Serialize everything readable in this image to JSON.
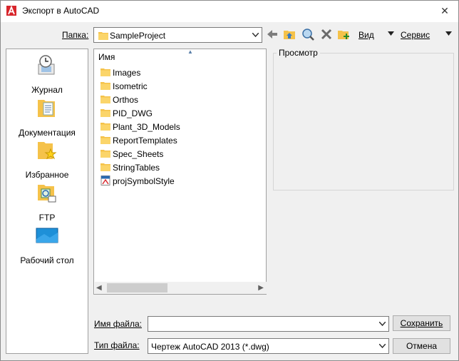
{
  "window": {
    "title": "Экспорт в AutoCAD",
    "close_glyph": "✕"
  },
  "lookin": {
    "label": "Папка:",
    "value": "SampleProject"
  },
  "toolbar": {
    "view_label": "Вид",
    "tools_label": "Сервис"
  },
  "places": [
    {
      "label": "Журнал",
      "icon": "history-icon"
    },
    {
      "label": "Документация",
      "icon": "documents-icon"
    },
    {
      "label": "Избранное",
      "icon": "favorites-icon"
    },
    {
      "label": "FTP",
      "icon": "ftp-icon"
    },
    {
      "label": "Рабочий стол",
      "icon": "desktop-icon"
    }
  ],
  "filelist": {
    "column_name": "Имя",
    "items": [
      {
        "name": "Images",
        "type": "folder"
      },
      {
        "name": "Isometric",
        "type": "folder"
      },
      {
        "name": "Orthos",
        "type": "folder"
      },
      {
        "name": "PID_DWG",
        "type": "folder"
      },
      {
        "name": "Plant_3D_Models",
        "type": "folder"
      },
      {
        "name": "ReportTemplates",
        "type": "folder"
      },
      {
        "name": "Spec_Sheets",
        "type": "folder"
      },
      {
        "name": "StringTables",
        "type": "folder"
      },
      {
        "name": "projSymbolStyle",
        "type": "drawing"
      }
    ]
  },
  "preview": {
    "title": "Просмотр"
  },
  "filename": {
    "label": "Имя файла:",
    "value": ""
  },
  "filetype": {
    "label": "Тип файла:",
    "value": "Чертеж AutoCAD 2013 (*.dwg)"
  },
  "buttons": {
    "save": "Сохранить",
    "cancel": "Отмена"
  },
  "colors": {
    "folder": "#f5c24a",
    "autocad_red": "#d8262c",
    "desktop_blue": "#1e90d8"
  }
}
